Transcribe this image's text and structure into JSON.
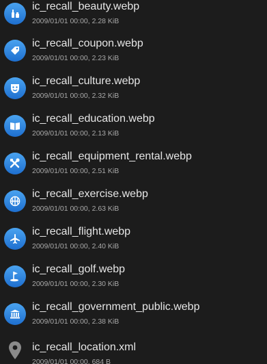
{
  "colors": {
    "background": "#1c1c1c",
    "icon_gradient_top": "#4aa3f0",
    "icon_gradient_bottom": "#1e6fcf",
    "name_text": "#e6e6e6",
    "meta_text": "#a9a9a9",
    "pin_icon": "#8a8a8a"
  },
  "files": [
    {
      "name": "ic_recall_beauty.webp",
      "meta": "2009/01/01 00:00, 2.28 KiB",
      "icon": "beauty-icon"
    },
    {
      "name": "ic_recall_coupon.webp",
      "meta": "2009/01/01 00:00, 2.23 KiB",
      "icon": "coupon-tag-icon"
    },
    {
      "name": "ic_recall_culture.webp",
      "meta": "2009/01/01 00:00, 2.32 KiB",
      "icon": "theater-mask-icon"
    },
    {
      "name": "ic_recall_education.webp",
      "meta": "2009/01/01 00:00, 2.13 KiB",
      "icon": "book-icon"
    },
    {
      "name": "ic_recall_equipment_rental.webp",
      "meta": "2009/01/01 00:00, 2.51 KiB",
      "icon": "tools-icon"
    },
    {
      "name": "ic_recall_exercise.webp",
      "meta": "2009/01/01 00:00, 2.63 KiB",
      "icon": "basketball-icon"
    },
    {
      "name": "ic_recall_flight.webp",
      "meta": "2009/01/01 00:00, 2.40 KiB",
      "icon": "airplane-icon"
    },
    {
      "name": "ic_recall_golf.webp",
      "meta": "2009/01/01 00:00, 2.30 KiB",
      "icon": "golf-flag-icon"
    },
    {
      "name": "ic_recall_government_public.webp",
      "meta": "2009/01/01 00:00, 2.38 KiB",
      "icon": "government-building-icon"
    },
    {
      "name": "ic_recall_location.xml",
      "meta": "2009/01/01 00:00, 684 B",
      "icon": "location-pin-icon"
    }
  ]
}
